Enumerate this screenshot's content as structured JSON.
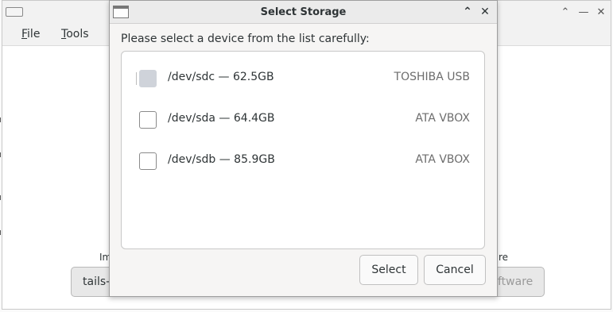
{
  "main_window": {
    "app_icon": "application-icon",
    "controls": {
      "maximize_icon": "chevron-up-icon",
      "minimize_icon": "minus-icon",
      "close_icon": "close-icon",
      "maximize_glyph": "⌃",
      "minimize_glyph": "—",
      "close_glyph": "✕"
    },
    "menu": {
      "file": {
        "mnemonic": "F",
        "rest": "ile"
      },
      "tools": {
        "mnemonic": "T",
        "rest": "ools"
      }
    },
    "background": {
      "left_label_partial": "Im",
      "right_label_partial": "re",
      "left_button_partial": "tails-",
      "right_button_partial": "ftware"
    }
  },
  "dialog": {
    "title": "Select Storage",
    "title_icon": "window-icon",
    "controls": {
      "maximize_icon": "chevron-up-icon",
      "close_icon": "close-icon",
      "maximize_glyph": "⌃",
      "close_glyph": "✕"
    },
    "prompt": "Please select a device from the list carefully:",
    "devices": [
      {
        "name": "/dev/sdc — 62.5GB",
        "vendor": "TOSHIBA USB",
        "checked": false,
        "disabled": true
      },
      {
        "name": "/dev/sda — 64.4GB",
        "vendor": "ATA VBOX",
        "checked": false,
        "disabled": false
      },
      {
        "name": "/dev/sdb — 85.9GB",
        "vendor": "ATA VBOX",
        "checked": false,
        "disabled": false
      }
    ],
    "buttons": {
      "select": "Select",
      "cancel": "Cancel"
    }
  }
}
